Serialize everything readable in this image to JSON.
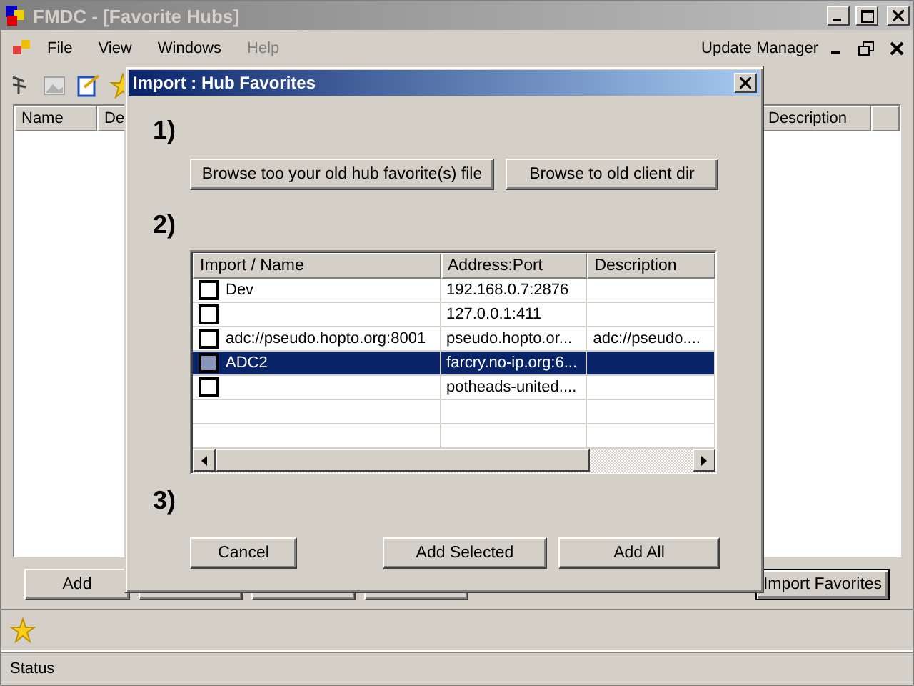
{
  "window": {
    "title": "FMDC - [Favorite Hubs]"
  },
  "menu": [
    {
      "label": "File",
      "disabled": false
    },
    {
      "label": "View",
      "disabled": false
    },
    {
      "label": "Windows",
      "disabled": false
    },
    {
      "label": "Help",
      "disabled": true
    }
  ],
  "update_manager": "Update Manager",
  "hub_list": {
    "columns": [
      "Name",
      "De",
      "Description"
    ]
  },
  "buttons": [
    "Add"
  ],
  "import_button": "Import Favorites",
  "status_bar": "Status",
  "dialog": {
    "title": "Import : Hub Favorites",
    "step_1": "1)",
    "browse_buttons": [
      "Browse too your old hub favorite(s) file",
      "Browse to old client dir"
    ],
    "step_2": "2)",
    "columns": [
      "Import / Name",
      "Address:Port",
      "Description"
    ],
    "rows": [
      {
        "name": "Dev",
        "address": "192.168.0.7:2876",
        "description": "",
        "checked": false,
        "selected": false
      },
      {
        "name": "",
        "address": "127.0.0.1:411",
        "description": "",
        "checked": false,
        "selected": false
      },
      {
        "name": "adc://pseudo.hopto.org:8001",
        "address": "pseudo.hopto.or...",
        "description": "adc://pseudo....",
        "checked": false,
        "selected": false
      },
      {
        "name": "ADC2",
        "address": "farcry.no-ip.org:6...",
        "description": "",
        "checked": false,
        "selected": true
      },
      {
        "name": "",
        "address": "potheads-united....",
        "description": "",
        "checked": false,
        "selected": false
      }
    ],
    "step_3": "3)",
    "cancel": "Cancel",
    "action_buttons": [
      "Add Selected",
      "Add All"
    ]
  }
}
